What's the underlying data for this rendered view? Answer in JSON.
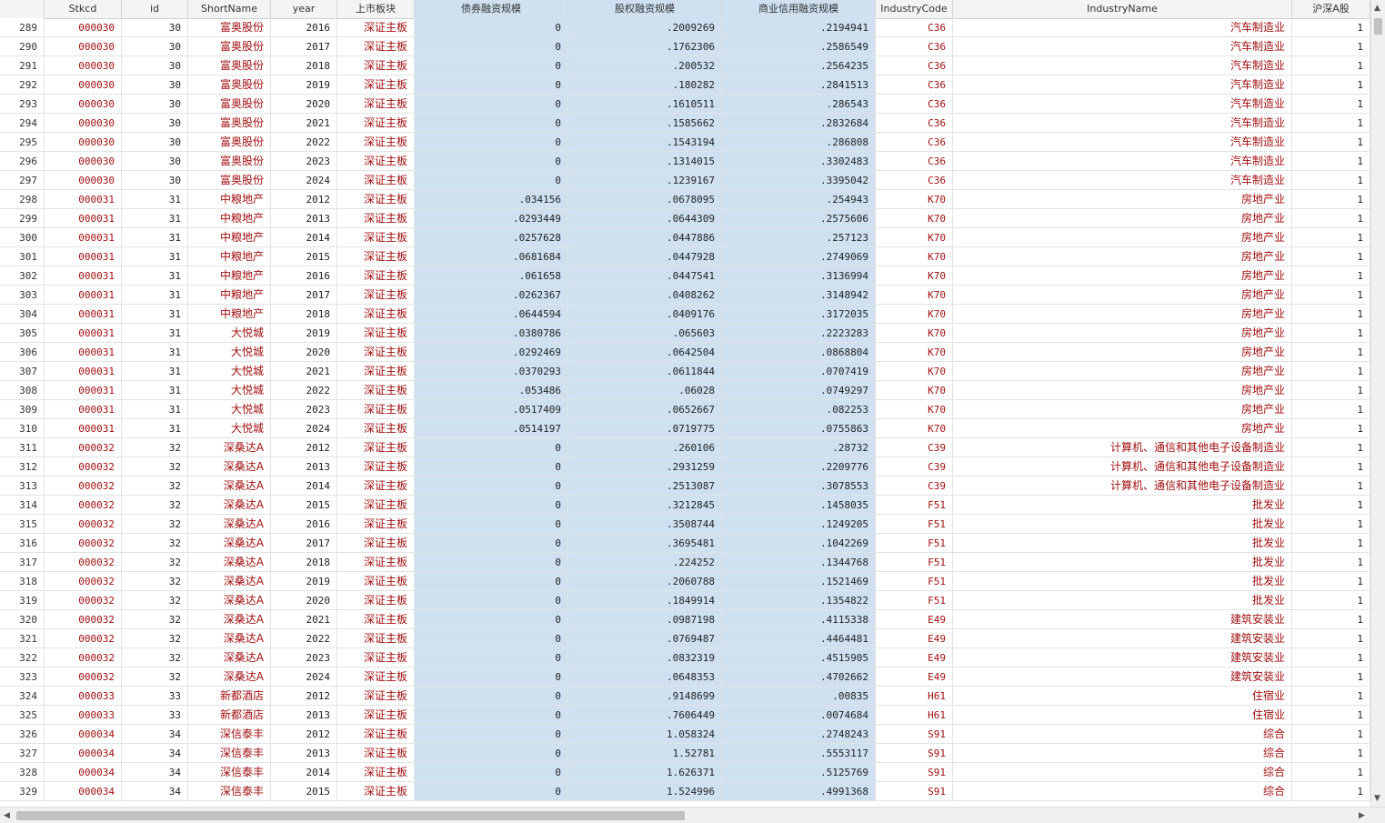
{
  "columns": [
    "",
    "Stkcd",
    "id",
    "ShortName",
    "year",
    "上市板块",
    "债券融资规模",
    "股权融资规模",
    "商业信用融资规模",
    "IndustryCode",
    "IndustryName",
    "沪深A股"
  ],
  "rows": [
    [
      "289",
      "000030",
      "30",
      "富奥股份",
      "2016",
      "深证主板",
      "0",
      ".2009269",
      ".2194941",
      "C36",
      "汽车制造业",
      "1"
    ],
    [
      "290",
      "000030",
      "30",
      "富奥股份",
      "2017",
      "深证主板",
      "0",
      ".1762306",
      ".2586549",
      "C36",
      "汽车制造业",
      "1"
    ],
    [
      "291",
      "000030",
      "30",
      "富奥股份",
      "2018",
      "深证主板",
      "0",
      ".200532",
      ".2564235",
      "C36",
      "汽车制造业",
      "1"
    ],
    [
      "292",
      "000030",
      "30",
      "富奥股份",
      "2019",
      "深证主板",
      "0",
      ".180282",
      ".2841513",
      "C36",
      "汽车制造业",
      "1"
    ],
    [
      "293",
      "000030",
      "30",
      "富奥股份",
      "2020",
      "深证主板",
      "0",
      ".1610511",
      ".286543",
      "C36",
      "汽车制造业",
      "1"
    ],
    [
      "294",
      "000030",
      "30",
      "富奥股份",
      "2021",
      "深证主板",
      "0",
      ".1585662",
      ".2832684",
      "C36",
      "汽车制造业",
      "1"
    ],
    [
      "295",
      "000030",
      "30",
      "富奥股份",
      "2022",
      "深证主板",
      "0",
      ".1543194",
      ".286808",
      "C36",
      "汽车制造业",
      "1"
    ],
    [
      "296",
      "000030",
      "30",
      "富奥股份",
      "2023",
      "深证主板",
      "0",
      ".1314015",
      ".3302483",
      "C36",
      "汽车制造业",
      "1"
    ],
    [
      "297",
      "000030",
      "30",
      "富奥股份",
      "2024",
      "深证主板",
      "0",
      ".1239167",
      ".3395042",
      "C36",
      "汽车制造业",
      "1"
    ],
    [
      "298",
      "000031",
      "31",
      "中粮地产",
      "2012",
      "深证主板",
      ".034156",
      ".0678095",
      ".254943",
      "K70",
      "房地产业",
      "1"
    ],
    [
      "299",
      "000031",
      "31",
      "中粮地产",
      "2013",
      "深证主板",
      ".0293449",
      ".0644309",
      ".2575606",
      "K70",
      "房地产业",
      "1"
    ],
    [
      "300",
      "000031",
      "31",
      "中粮地产",
      "2014",
      "深证主板",
      ".0257628",
      ".0447886",
      ".257123",
      "K70",
      "房地产业",
      "1"
    ],
    [
      "301",
      "000031",
      "31",
      "中粮地产",
      "2015",
      "深证主板",
      ".0681684",
      ".0447928",
      ".2749069",
      "K70",
      "房地产业",
      "1"
    ],
    [
      "302",
      "000031",
      "31",
      "中粮地产",
      "2016",
      "深证主板",
      ".061658",
      ".0447541",
      ".3136994",
      "K70",
      "房地产业",
      "1"
    ],
    [
      "303",
      "000031",
      "31",
      "中粮地产",
      "2017",
      "深证主板",
      ".0262367",
      ".0408262",
      ".3148942",
      "K70",
      "房地产业",
      "1"
    ],
    [
      "304",
      "000031",
      "31",
      "中粮地产",
      "2018",
      "深证主板",
      ".0644594",
      ".0409176",
      ".3172035",
      "K70",
      "房地产业",
      "1"
    ],
    [
      "305",
      "000031",
      "31",
      "大悦城",
      "2019",
      "深证主板",
      ".0380786",
      ".065603",
      ".2223283",
      "K70",
      "房地产业",
      "1"
    ],
    [
      "306",
      "000031",
      "31",
      "大悦城",
      "2020",
      "深证主板",
      ".0292469",
      ".0642504",
      ".0868804",
      "K70",
      "房地产业",
      "1"
    ],
    [
      "307",
      "000031",
      "31",
      "大悦城",
      "2021",
      "深证主板",
      ".0370293",
      ".0611844",
      ".0707419",
      "K70",
      "房地产业",
      "1"
    ],
    [
      "308",
      "000031",
      "31",
      "大悦城",
      "2022",
      "深证主板",
      ".053486",
      ".06028",
      ".0749297",
      "K70",
      "房地产业",
      "1"
    ],
    [
      "309",
      "000031",
      "31",
      "大悦城",
      "2023",
      "深证主板",
      ".0517409",
      ".0652667",
      ".082253",
      "K70",
      "房地产业",
      "1"
    ],
    [
      "310",
      "000031",
      "31",
      "大悦城",
      "2024",
      "深证主板",
      ".0514197",
      ".0719775",
      ".0755863",
      "K70",
      "房地产业",
      "1"
    ],
    [
      "311",
      "000032",
      "32",
      "深桑达A",
      "2012",
      "深证主板",
      "0",
      ".260106",
      ".28732",
      "C39",
      "计算机、通信和其他电子设备制造业",
      "1"
    ],
    [
      "312",
      "000032",
      "32",
      "深桑达A",
      "2013",
      "深证主板",
      "0",
      ".2931259",
      ".2209776",
      "C39",
      "计算机、通信和其他电子设备制造业",
      "1"
    ],
    [
      "313",
      "000032",
      "32",
      "深桑达A",
      "2014",
      "深证主板",
      "0",
      ".2513087",
      ".3078553",
      "C39",
      "计算机、通信和其他电子设备制造业",
      "1"
    ],
    [
      "314",
      "000032",
      "32",
      "深桑达A",
      "2015",
      "深证主板",
      "0",
      ".3212845",
      ".1458035",
      "F51",
      "批发业",
      "1"
    ],
    [
      "315",
      "000032",
      "32",
      "深桑达A",
      "2016",
      "深证主板",
      "0",
      ".3508744",
      ".1249205",
      "F51",
      "批发业",
      "1"
    ],
    [
      "316",
      "000032",
      "32",
      "深桑达A",
      "2017",
      "深证主板",
      "0",
      ".3695481",
      ".1042269",
      "F51",
      "批发业",
      "1"
    ],
    [
      "317",
      "000032",
      "32",
      "深桑达A",
      "2018",
      "深证主板",
      "0",
      ".224252",
      ".1344768",
      "F51",
      "批发业",
      "1"
    ],
    [
      "318",
      "000032",
      "32",
      "深桑达A",
      "2019",
      "深证主板",
      "0",
      ".2060788",
      ".1521469",
      "F51",
      "批发业",
      "1"
    ],
    [
      "319",
      "000032",
      "32",
      "深桑达A",
      "2020",
      "深证主板",
      "0",
      ".1849914",
      ".1354822",
      "F51",
      "批发业",
      "1"
    ],
    [
      "320",
      "000032",
      "32",
      "深桑达A",
      "2021",
      "深证主板",
      "0",
      ".0987198",
      ".4115338",
      "E49",
      "建筑安装业",
      "1"
    ],
    [
      "321",
      "000032",
      "32",
      "深桑达A",
      "2022",
      "深证主板",
      "0",
      ".0769487",
      ".4464481",
      "E49",
      "建筑安装业",
      "1"
    ],
    [
      "322",
      "000032",
      "32",
      "深桑达A",
      "2023",
      "深证主板",
      "0",
      ".0832319",
      ".4515905",
      "E49",
      "建筑安装业",
      "1"
    ],
    [
      "323",
      "000032",
      "32",
      "深桑达A",
      "2024",
      "深证主板",
      "0",
      ".0648353",
      ".4702662",
      "E49",
      "建筑安装业",
      "1"
    ],
    [
      "324",
      "000033",
      "33",
      "新都酒店",
      "2012",
      "深证主板",
      "0",
      ".9148699",
      ".00835",
      "H61",
      "住宿业",
      "1"
    ],
    [
      "325",
      "000033",
      "33",
      "新都酒店",
      "2013",
      "深证主板",
      "0",
      ".7606449",
      ".0074684",
      "H61",
      "住宿业",
      "1"
    ],
    [
      "326",
      "000034",
      "34",
      "深信泰丰",
      "2012",
      "深证主板",
      "0",
      "1.058324",
      ".2748243",
      "S91",
      "综合",
      "1"
    ],
    [
      "327",
      "000034",
      "34",
      "深信泰丰",
      "2013",
      "深证主板",
      "0",
      "1.52781",
      ".5553117",
      "S91",
      "综合",
      "1"
    ],
    [
      "328",
      "000034",
      "34",
      "深信泰丰",
      "2014",
      "深证主板",
      "0",
      "1.626371",
      ".5125769",
      "S91",
      "综合",
      "1"
    ],
    [
      "329",
      "000034",
      "34",
      "深信泰丰",
      "2015",
      "深证主板",
      "0",
      "1.524996",
      ".4991368",
      "S91",
      "综合",
      "1"
    ]
  ],
  "scrollbar_icons": {
    "up": "▲",
    "down": "▼",
    "left": "◀",
    "right": "▶"
  }
}
